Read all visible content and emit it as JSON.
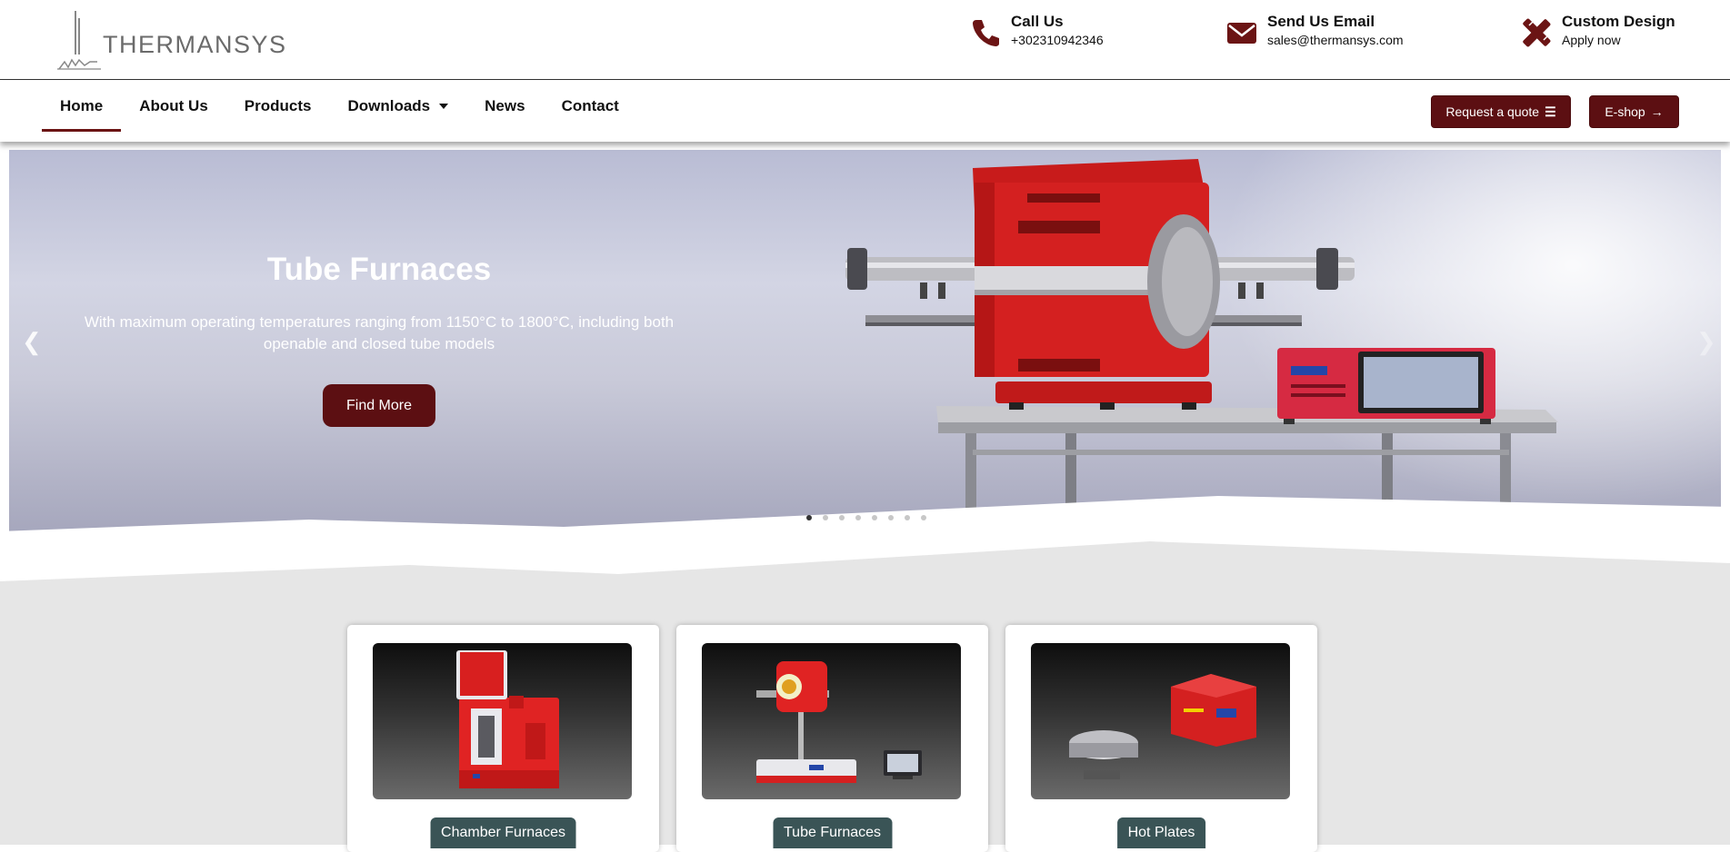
{
  "brand": {
    "name": "THERMANSYS"
  },
  "contacts": {
    "call": {
      "title": "Call Us",
      "value": "+302310942346",
      "icon": "phone-icon"
    },
    "email": {
      "title": "Send Us Email",
      "value": "sales@thermansys.com",
      "icon": "envelope-icon"
    },
    "design": {
      "title": "Custom Design",
      "value": "Apply now",
      "icon": "design-tools-icon"
    }
  },
  "nav": {
    "items": [
      {
        "label": "Home",
        "active": true
      },
      {
        "label": "About Us"
      },
      {
        "label": "Products"
      },
      {
        "label": "Downloads",
        "has_dropdown": true
      },
      {
        "label": "News"
      },
      {
        "label": "Contact"
      }
    ],
    "request_quote": "Request a quote",
    "eshop": "E-shop"
  },
  "hero": {
    "title": "Tube Furnaces",
    "description": "With maximum operating temperatures ranging from 1150°C to 1800°C, including both openable and closed tube models",
    "button": "Find More",
    "slide_count": 8,
    "active_slide": 1
  },
  "cards": [
    {
      "label": "Chamber Furnaces"
    },
    {
      "label": "Tube Furnaces"
    },
    {
      "label": "Hot Plates"
    }
  ],
  "colors": {
    "brand": "#5c0f12",
    "card_label": "#3a5456",
    "section_bg": "#e6e6e6"
  }
}
